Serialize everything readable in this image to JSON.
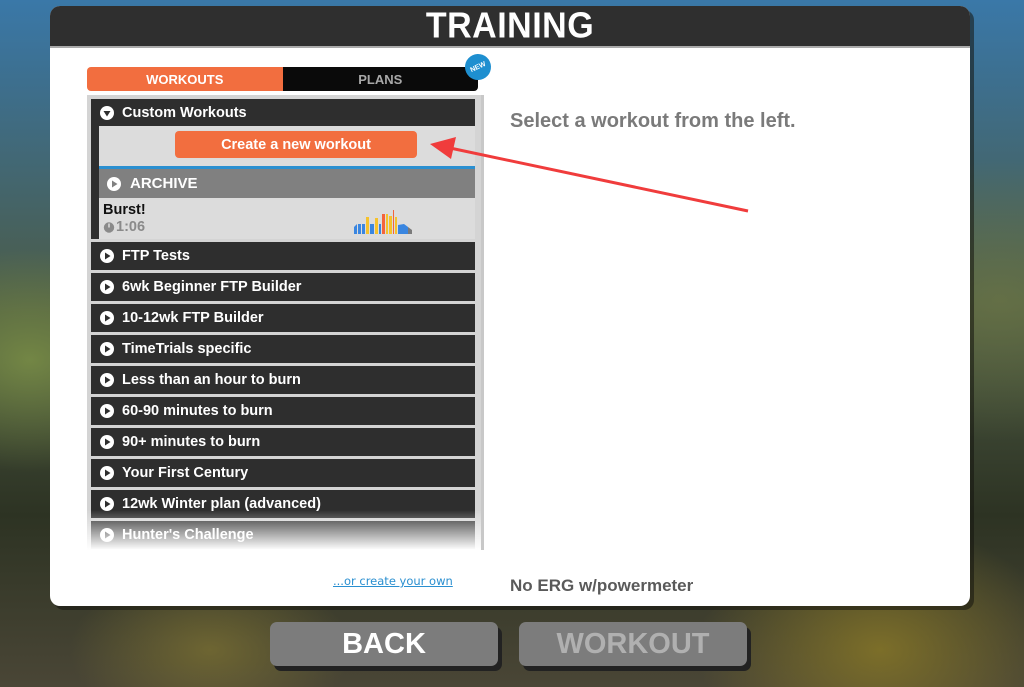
{
  "header": {
    "title": "TRAINING"
  },
  "tabs": [
    {
      "label": "WORKOUTS",
      "active": true
    },
    {
      "label": "PLANS",
      "active": false
    }
  ],
  "new_badge": "NEW",
  "custom_workouts": {
    "label": "Custom Workouts",
    "expanded": true,
    "create_button": "Create a new workout",
    "archive_label": "ARCHIVE",
    "workouts": [
      {
        "name": "Burst!",
        "duration": "1:06"
      }
    ]
  },
  "categories": [
    {
      "label": "FTP Tests"
    },
    {
      "label": "6wk Beginner FTP Builder"
    },
    {
      "label": "10-12wk FTP Builder"
    },
    {
      "label": "TimeTrials specific"
    },
    {
      "label": "Less than an hour to burn"
    },
    {
      "label": "60-90 minutes to burn"
    },
    {
      "label": "90+ minutes to burn"
    },
    {
      "label": "Your First Century"
    },
    {
      "label": "12wk Winter plan (advanced)"
    },
    {
      "label": "Hunter's Challenge"
    }
  ],
  "detail": {
    "placeholder_message": "Select a workout from the left."
  },
  "footer": {
    "create_own_link": "...or create your own",
    "erg_status": "No ERG w/powermeter"
  },
  "buttons": {
    "back": "BACK",
    "workout": "WORKOUT"
  },
  "colors": {
    "accent": "#f26e3f",
    "header": "#2f2f2f",
    "link": "#2a8fd0",
    "annotation_arrow": "#f03c3c"
  },
  "annotation": {
    "type": "arrow",
    "points_to": "create-new-workout-button"
  }
}
